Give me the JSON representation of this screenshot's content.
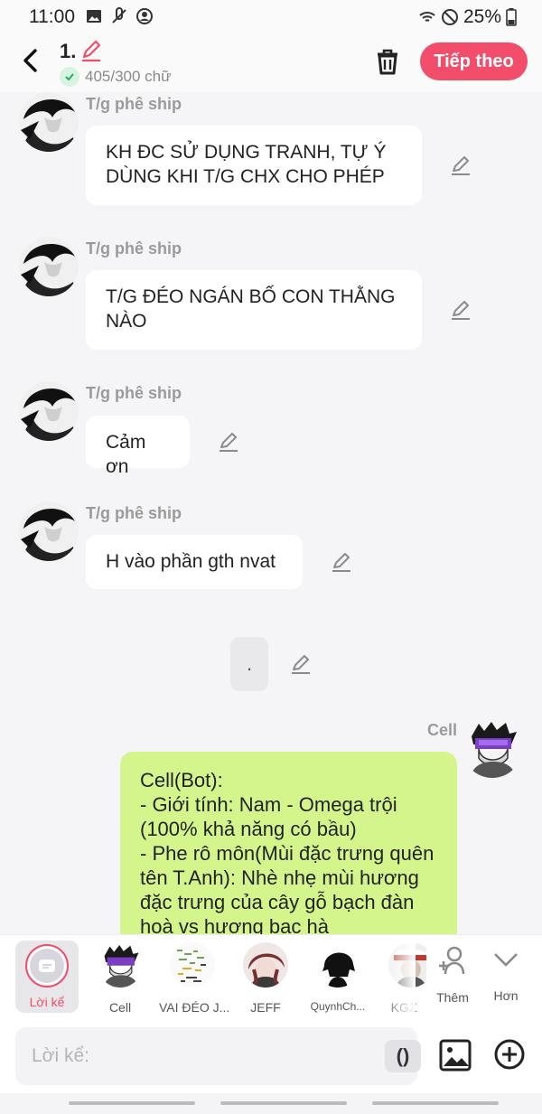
{
  "status": {
    "time": "11:00",
    "battery": "25%"
  },
  "header": {
    "title": "1.",
    "count": "405/300 chữ",
    "next_label": "Tiếp theo"
  },
  "messages": [
    {
      "sender": "T/g phê ship",
      "text": "KH ĐC SỬ DỤNG TRANH, TỰ Ý\nDÙNG KHI T/G CHX CHO PHÉP"
    },
    {
      "sender": "T/g phê ship",
      "text": "T/G ĐÉO NGÁN BỐ CON THẰNG\nNÀO"
    },
    {
      "sender": "T/g phê ship",
      "text": "Cảm ơn"
    },
    {
      "sender": "T/g phê ship",
      "text": "H vào phần gth nvat"
    }
  ],
  "narration_dot": ".",
  "reply": {
    "sender": "Cell",
    "text": "Cell(Bot):\n- Giới tính: Nam - Omega trội (100% khả năng có bầu)\n- Phe rô môn(Mùi đặc trưng quên tên T.Anh): Nhè nhẹ mùi hương đặc trưng của  cây gỗ bạch đàn hoà vs hương bạc hà"
  },
  "characters": {
    "narrator": "Lời kể",
    "list": [
      "Cell",
      "VAI ĐÉO J...",
      "JEFF",
      "QuynhCh...",
      "KGZ"
    ],
    "add": "Thêm",
    "more": "Hơn"
  },
  "input": {
    "placeholder": "Lời kể:",
    "paren": "()"
  },
  "colors": {
    "accent": "#f24d6b",
    "reply_bubble": "#d4f58b",
    "background": "#f5f5f7"
  }
}
